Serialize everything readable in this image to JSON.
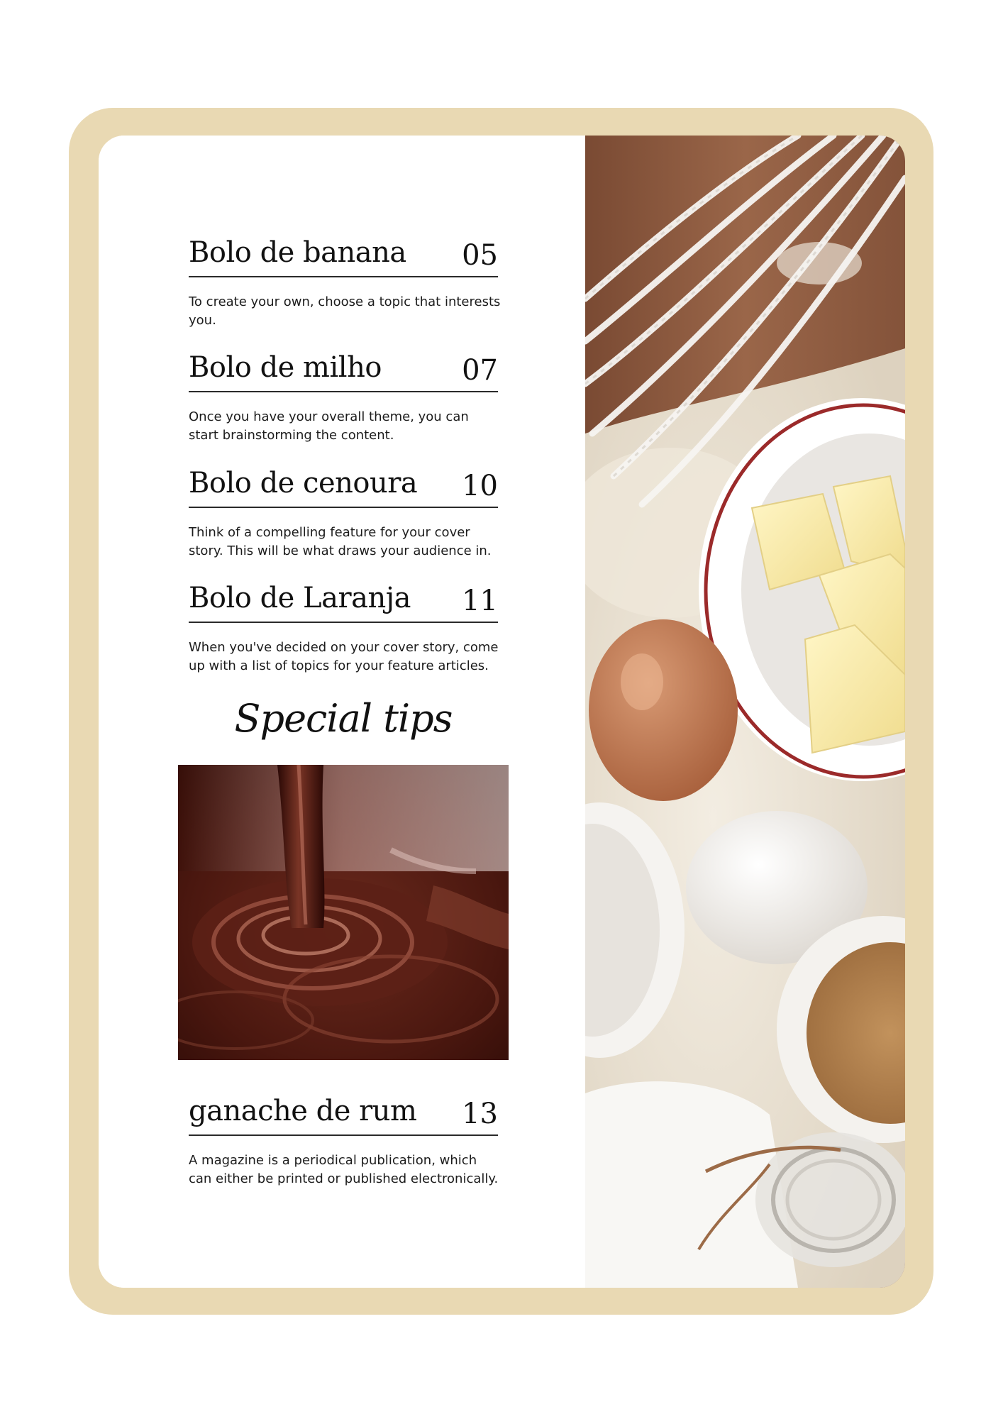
{
  "entries": [
    {
      "title": "Bolo de banana",
      "page": "05",
      "description": "To create your own, choose a topic that interests you."
    },
    {
      "title": "Bolo de milho",
      "page": "07",
      "description": "Once you have your overall theme, you can start brainstorming the content."
    },
    {
      "title": "Bolo de cenoura",
      "page": "10",
      "description": "Think of a compelling feature for your cover story. This will be what draws your audience in."
    },
    {
      "title": "Bolo de Laranja",
      "page": "11",
      "description": "When you've decided on your cover story, come up with a list of topics for your feature articles."
    }
  ],
  "special": {
    "heading": "Special tips",
    "title": "ganache de rum",
    "page": "13",
    "description": "A magazine is a periodical publication, which can either be printed or published electronically."
  },
  "colors": {
    "frame": "#e9d9b3",
    "card": "#ffffff",
    "text": "#111111",
    "rule": "#2a2a2a",
    "wood": "#8f5a3e",
    "chocolate": "#5a1e14"
  }
}
